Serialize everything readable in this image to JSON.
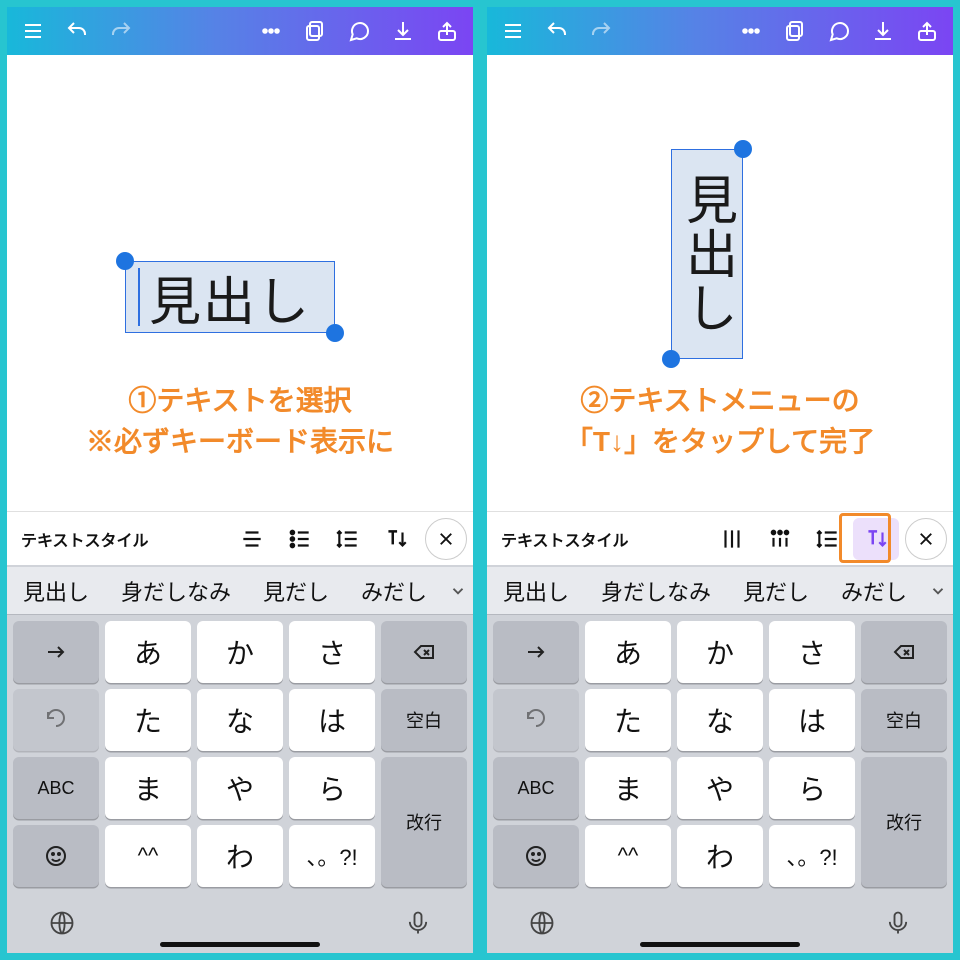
{
  "left": {
    "canvas_text": "見出し",
    "annotation": "①テキストを選択\n※必ずキーボード表示に",
    "text_toolbar": {
      "style_label": "テキストスタイル",
      "icons": [
        "align-icon",
        "list-bullets-icon",
        "line-spacing-icon",
        "text-vertical-icon"
      ]
    }
  },
  "right": {
    "canvas_text": "見出し",
    "annotation": "②テキストメニューの\n「T↓」をタップして完了",
    "text_toolbar": {
      "style_label": "テキストスタイル",
      "icons": [
        "align-bars-icon",
        "dots-grid-icon",
        "line-spacing-icon",
        "text-vertical-icon"
      ],
      "active_index": 3
    }
  },
  "keyboard": {
    "predictions": [
      "見出し",
      "身だしなみ",
      "見だし",
      "みだし"
    ],
    "rows": [
      [
        "→",
        "あ",
        "か",
        "さ",
        "⌫"
      ],
      [
        "↺",
        "た",
        "な",
        "は",
        "空白"
      ],
      [
        "ABC",
        "ま",
        "や",
        "ら",
        "改行"
      ],
      [
        "😊",
        "^^",
        "わ",
        "、。?!",
        ""
      ]
    ],
    "space_label": "空白",
    "return_label": "改行",
    "abc_label": "ABC"
  }
}
